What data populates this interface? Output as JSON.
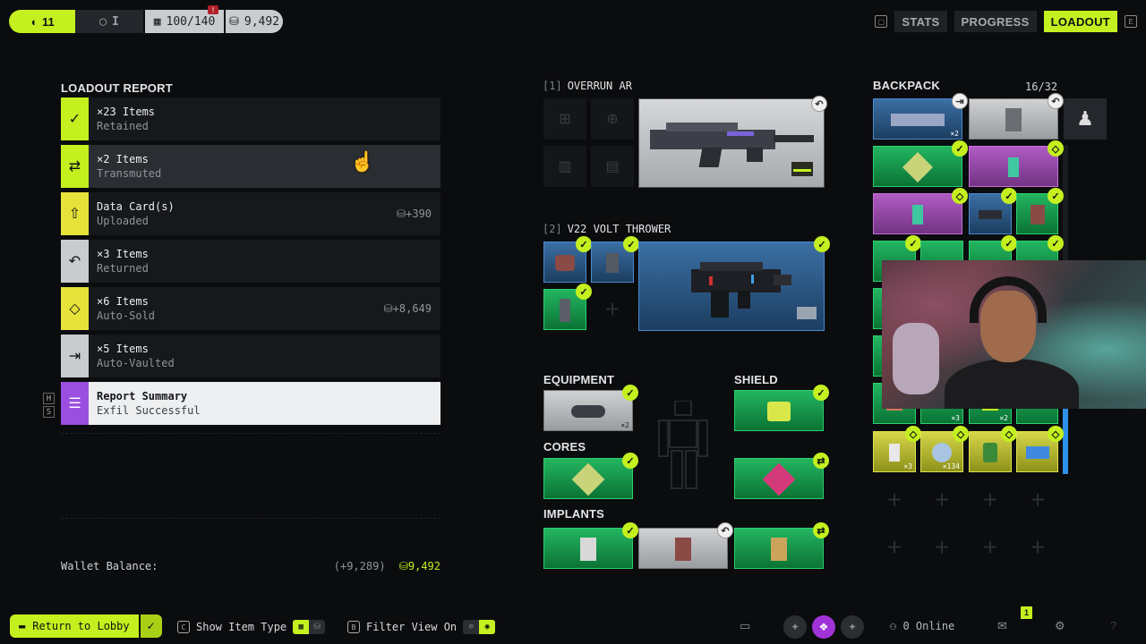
{
  "topbar": {
    "level": "11",
    "rank": "I",
    "capacity": "100/140",
    "capacity_badge": "!",
    "currency": "9,492",
    "nav": {
      "stats": "STATS",
      "progress": "PROGRESS",
      "loadout": "LOADOUT"
    }
  },
  "report": {
    "title": "LOADOUT REPORT",
    "rows": [
      {
        "line1": "×23 Items",
        "line2": "Retained",
        "value": "",
        "color": "#c4f01f",
        "icon": "check-icon"
      },
      {
        "line1": "×2 Items",
        "line2": "Transmuted",
        "value": "",
        "color": "#c4f01f",
        "icon": "transmute-icon"
      },
      {
        "line1": "Data Card(s)",
        "line2": "Uploaded",
        "value": "⛁+390",
        "color": "#e6e23a",
        "icon": "upload-icon"
      },
      {
        "line1": "×3 Items",
        "line2": "Returned",
        "value": "",
        "color": "#c9ccce",
        "icon": "return-icon"
      },
      {
        "line1": "×6 Items",
        "line2": "Auto-Sold",
        "value": "⛁+8,649",
        "color": "#e6e23a",
        "icon": "sold-icon"
      },
      {
        "line1": "×5 Items",
        "line2": "Auto-Vaulted",
        "value": "",
        "color": "#c9ccce",
        "icon": "vault-icon"
      },
      {
        "line1": "Report Summary",
        "line2": "Exfil Successful",
        "value": "",
        "color": "#9a4fe0",
        "icon": "list-icon"
      }
    ],
    "hotkeys": [
      "H",
      "S"
    ],
    "wallet_label": "Wallet Balance:",
    "wallet_delta": "(+9,289)",
    "wallet_balance": "⛁9,492"
  },
  "weapons": {
    "primary": {
      "index": "[1]",
      "name": "OVERRUN AR"
    },
    "secondary": {
      "index": "[2]",
      "name": "V22 VOLT THROWER"
    }
  },
  "equipment": {
    "equipment_label": "EQUIPMENT",
    "equipment_count": "×2",
    "shield_label": "SHIELD",
    "cores_label": "CORES",
    "implants_label": "IMPLANTS"
  },
  "backpack": {
    "title": "BACKPACK",
    "count": "16/32",
    "counts": [
      "×2",
      "×3",
      "×2",
      "×3",
      "×134"
    ]
  },
  "bottombar": {
    "return_label": "Return to Lobby",
    "show_item_type": "Show Item Type",
    "filter_view": "Filter View On",
    "online": "0 Online",
    "notif_count": "1"
  },
  "colors": {
    "accent": "#c4f01f",
    "gold": "#e6e23a",
    "purple": "#9a4fe0"
  }
}
